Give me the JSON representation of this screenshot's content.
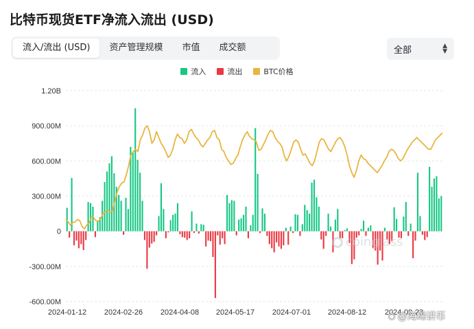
{
  "title": "比特币现货ETF净流入流出 (USD)",
  "tabs": [
    {
      "label": "流入/流出 (USD)",
      "active": true
    },
    {
      "label": "资产管理规模",
      "active": false
    },
    {
      "label": "市值",
      "active": false
    },
    {
      "label": "成交额",
      "active": false
    }
  ],
  "filter": {
    "value": "全部"
  },
  "watermark": {
    "logo_text": "coinglass",
    "weibo_text": "@海绵讲币"
  },
  "chart_data": {
    "type": "bar",
    "legend": [
      {
        "name": "流入",
        "color": "#16c784"
      },
      {
        "name": "流出",
        "color": "#ea3943"
      },
      {
        "name": "BTC价格",
        "color": "#e8b53f"
      }
    ],
    "yaxis": {
      "ticks": [
        1200,
        900,
        600,
        300,
        0,
        -300,
        -600
      ],
      "tick_labels": [
        "1.20B",
        "900.00M",
        "600.00M",
        "300.00M",
        "0",
        "-300.00M",
        "-600.00M"
      ],
      "range": [
        -600,
        1200
      ],
      "unit": "M USD"
    },
    "xaxis": {
      "tick_labels": [
        "2024-01-12",
        "2024-02-26",
        "2024-04-08",
        "2024-05-17",
        "2024-07-01",
        "2024-08-12",
        "2024-09-23"
      ]
    },
    "flows_musd": [
      200,
      -55,
      455,
      -120,
      -80,
      -145,
      -110,
      -160,
      -75,
      250,
      240,
      210,
      -50,
      85,
      120,
      260,
      420,
      510,
      580,
      640,
      495,
      380,
      310,
      260,
      -30,
      285,
      190,
      720,
      680,
      1050,
      610,
      500,
      260,
      -75,
      -320,
      -140,
      -105,
      -90,
      -35,
      130,
      410,
      190,
      -60,
      -10,
      95,
      140,
      150,
      240,
      -25,
      -50,
      -55,
      -75,
      -60,
      170,
      -15,
      65,
      -20,
      60,
      55,
      -130,
      -80,
      -85,
      -220,
      -570,
      -35,
      -115,
      -60,
      -110,
      310,
      240,
      265,
      260,
      -35,
      100,
      110,
      140,
      210,
      -60,
      50,
      140,
      880,
      490,
      -15,
      195,
      150,
      -40,
      -110,
      -145,
      -180,
      -95,
      -130,
      -150,
      -120,
      30,
      -115,
      40,
      -15,
      145,
      140,
      -40,
      60,
      225,
      180,
      150,
      415,
      440,
      290,
      210,
      -70,
      -150,
      -40,
      150,
      40,
      -180,
      100,
      190,
      -60,
      -60,
      10,
      25,
      -100,
      -280,
      -240,
      -55,
      -35,
      20,
      90,
      -40,
      30,
      50,
      -145,
      -165,
      -285,
      -165,
      -250,
      30,
      -70,
      -110,
      -85,
      205,
      105,
      -55,
      -60,
      125,
      250,
      -40,
      65,
      -230,
      -80,
      500,
      130,
      -30,
      -75,
      -50,
      550,
      380,
      450,
      470,
      280,
      300
    ],
    "btc_price_scaled": [
      100,
      80,
      50,
      75,
      80,
      100,
      90,
      40,
      20,
      55,
      70,
      120,
      115,
      90,
      85,
      110,
      150,
      165,
      180,
      160,
      170,
      250,
      330,
      380,
      410,
      420,
      480,
      560,
      650,
      680,
      700,
      680,
      780,
      820,
      880,
      900,
      850,
      750,
      780,
      850,
      800,
      750,
      720,
      680,
      630,
      650,
      700,
      780,
      830,
      800,
      790,
      750,
      780,
      850,
      870,
      830,
      800,
      780,
      740,
      720,
      750,
      780,
      800,
      850,
      860,
      800,
      780,
      700,
      680,
      630,
      600,
      570,
      580,
      620,
      650,
      720,
      780,
      820,
      850,
      810,
      790,
      780,
      760,
      690,
      700,
      740,
      780,
      830,
      860,
      850,
      800,
      770,
      750,
      720,
      640,
      600,
      640,
      700,
      760,
      780,
      760,
      700,
      650,
      660,
      620,
      580,
      560,
      600,
      680,
      760,
      790,
      780,
      740,
      700,
      680,
      720,
      760,
      790,
      800,
      770,
      720,
      650,
      560,
      500,
      460,
      520,
      600,
      650,
      620,
      610,
      580,
      560,
      540,
      520,
      500,
      530,
      560,
      600,
      630,
      680,
      700,
      690,
      660,
      620,
      600,
      620,
      660,
      700,
      730,
      760,
      780,
      800,
      780,
      760,
      740,
      720,
      700,
      700,
      740,
      780,
      800,
      820,
      840
    ],
    "price_series_name": "BTC价格"
  }
}
